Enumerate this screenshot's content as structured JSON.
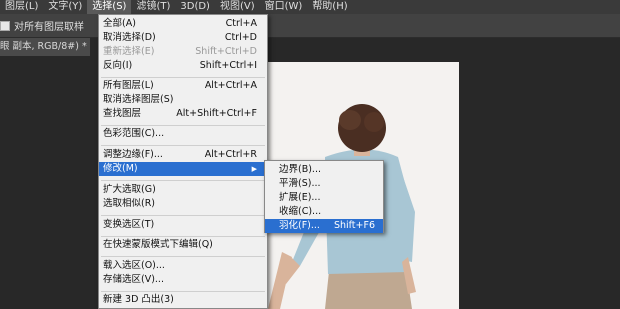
{
  "menubar": {
    "items": [
      "图层(L)",
      "文字(Y)",
      "选择(S)",
      "滤镜(T)",
      "3D(D)",
      "视图(V)",
      "窗口(W)",
      "帮助(H)"
    ]
  },
  "options_bar": {
    "sample_all_layers_label": "对所有图层取样"
  },
  "document_tab": {
    "title": "眼 副本, RGB/8#) *"
  },
  "select_menu": {
    "items": [
      {
        "label": "全部(A)",
        "shortcut": "Ctrl+A"
      },
      {
        "label": "取消选择(D)",
        "shortcut": "Ctrl+D"
      },
      {
        "label": "重新选择(E)",
        "shortcut": "Shift+Ctrl+D"
      },
      {
        "label": "反向(I)",
        "shortcut": "Shift+Ctrl+I"
      },
      {
        "label": "所有图层(L)",
        "shortcut": "Alt+Ctrl+A"
      },
      {
        "label": "取消选择图层(S)",
        "shortcut": ""
      },
      {
        "label": "查找图层",
        "shortcut": "Alt+Shift+Ctrl+F"
      },
      {
        "label": "色彩范围(C)...",
        "shortcut": ""
      },
      {
        "label": "调整边缘(F)...",
        "shortcut": "Alt+Ctrl+R"
      },
      {
        "label": "修改(M)",
        "shortcut": ""
      },
      {
        "label": "扩大选取(G)",
        "shortcut": ""
      },
      {
        "label": "选取相似(R)",
        "shortcut": ""
      },
      {
        "label": "变换选区(T)",
        "shortcut": ""
      },
      {
        "label": "在快速蒙版模式下编辑(Q)",
        "shortcut": ""
      },
      {
        "label": "载入选区(O)...",
        "shortcut": ""
      },
      {
        "label": "存储选区(V)...",
        "shortcut": ""
      },
      {
        "label": "新建 3D 凸出(3)",
        "shortcut": ""
      }
    ]
  },
  "modify_submenu": {
    "items": [
      {
        "label": "边界(B)...",
        "shortcut": ""
      },
      {
        "label": "平滑(S)...",
        "shortcut": ""
      },
      {
        "label": "扩展(E)...",
        "shortcut": ""
      },
      {
        "label": "收缩(C)...",
        "shortcut": ""
      },
      {
        "label": "羽化(F)...",
        "shortcut": "Shift+F6"
      }
    ]
  },
  "colors": {
    "highlight": "#2a6fd0",
    "menubar_bg": "#3a3a3a",
    "menu_bg": "#f0f0f0"
  }
}
